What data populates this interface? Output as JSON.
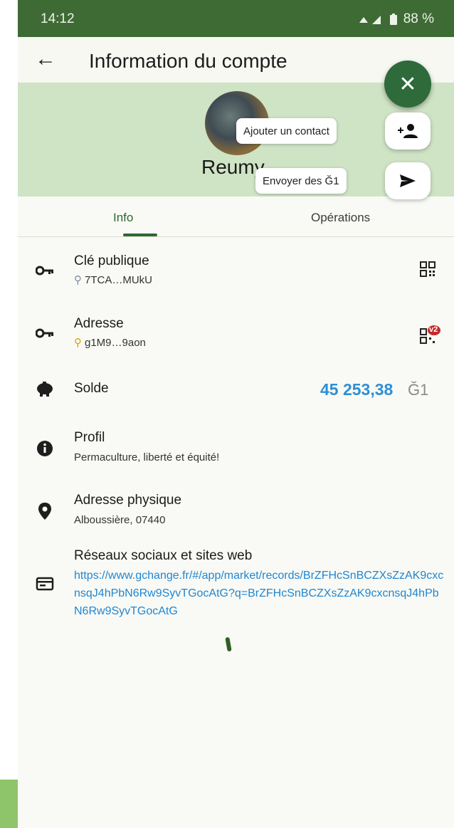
{
  "status_bar": {
    "time": "14:12",
    "battery": "88 %"
  },
  "app_bar": {
    "back_icon": "arrow-left-icon",
    "title": "Information du compte"
  },
  "profile": {
    "name": "Reumy"
  },
  "fab": {
    "close_icon": "close-icon",
    "add_contact_label": "Ajouter un contact",
    "send_label": "Envoyer des Ğ1"
  },
  "tabs": [
    {
      "label": "Info"
    },
    {
      "label": "Opérations"
    }
  ],
  "rows": {
    "public_key": {
      "title": "Clé publique",
      "value": "7TCA…MUkU"
    },
    "address": {
      "title": "Adresse",
      "value": "g1M9…9aon",
      "badge": "v2"
    },
    "balance": {
      "title": "Solde",
      "amount": "45 253,38",
      "currency": "Ğ1"
    },
    "profile": {
      "title": "Profil",
      "value": "Permaculture, liberté et équité!"
    },
    "physical_address": {
      "title": "Adresse physique",
      "value": "Alboussière, 07440"
    },
    "social": {
      "title": "Réseaux sociaux et sites web",
      "link": "https://www.gchange.fr/#/app/market/records/BrZFHcSnBCZXsZzAK9cxcnsqJ4hPbN6Rw9SyvTGocAtG?q=BrZFHcSnBCZXsZzAK9cxcnsqJ4hPbN6Rw9SyvTGocAtG"
    }
  },
  "colors": {
    "primary": "#2e6a3a",
    "header": "#cfe3c5",
    "link": "#1f86d4",
    "balance": "#2e8fd6"
  }
}
